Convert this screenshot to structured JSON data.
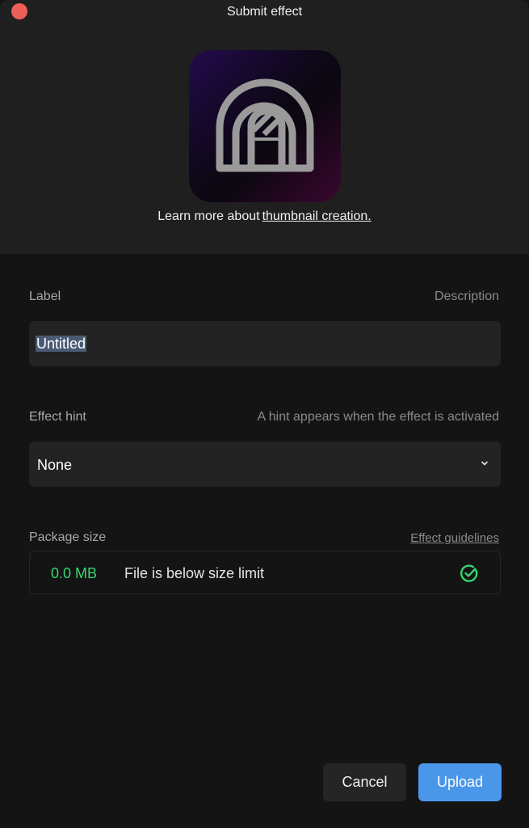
{
  "window": {
    "title": "Submit effect"
  },
  "thumbnail": {
    "icon": "arch-window-icon",
    "learn_more_text": "Learn more about",
    "learn_more_link": "thumbnail creation."
  },
  "label_field": {
    "label": "Label",
    "right_label": "Description",
    "value": "Untitled"
  },
  "hint_field": {
    "label": "Effect hint",
    "right_label": "A hint appears when the effect is activated",
    "value": "None"
  },
  "package": {
    "label": "Package size",
    "guidelines_link": "Effect guidelines",
    "size": "0.0 MB",
    "status": "File is below size limit",
    "status_icon": "check-circle-icon"
  },
  "actions": {
    "cancel": "Cancel",
    "upload": "Upload"
  },
  "colors": {
    "accent": "#4a97ea",
    "success": "#35d66f",
    "close": "#ec5f57"
  }
}
